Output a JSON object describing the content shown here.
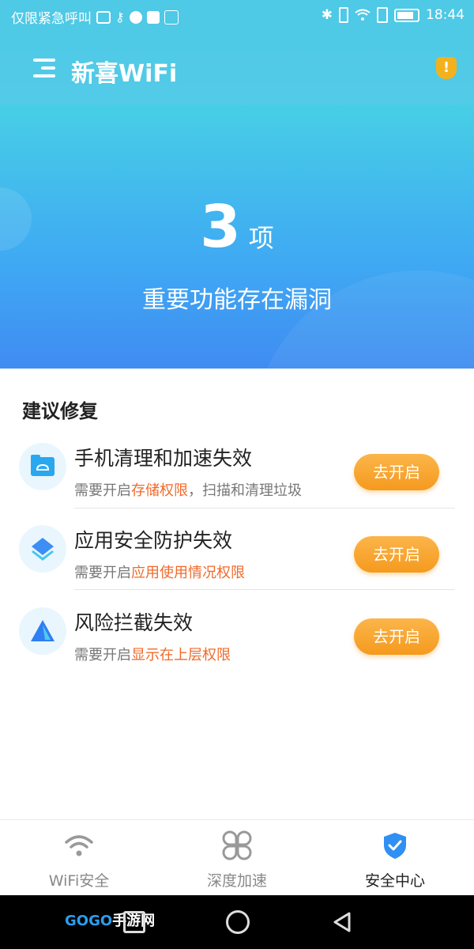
{
  "status_bar": {
    "left_text": "仅限紧急呼叫",
    "time": "18:44"
  },
  "app_bar": {
    "title": "新喜WiFi",
    "alert_mark": "!"
  },
  "hero": {
    "count": "3",
    "unit": "项",
    "subtitle": "重要功能存在漏洞"
  },
  "section": {
    "title": "建议修复"
  },
  "items": [
    {
      "title": "手机清理和加速失效",
      "desc_prefix": "需要开启",
      "desc_highlight": "存储权限",
      "desc_suffix": "，扫描和清理垃圾",
      "button": "去开启",
      "icon": "folder-cloud-icon"
    },
    {
      "title": "应用安全防护失效",
      "desc_prefix": "需要开启",
      "desc_highlight": "应用使用情况权限",
      "desc_suffix": "",
      "button": "去开启",
      "icon": "layers-icon"
    },
    {
      "title": "风险拦截失效",
      "desc_prefix": "需要开启",
      "desc_highlight": "显示在上层权限",
      "desc_suffix": "",
      "button": "去开启",
      "icon": "warning-triangle-icon"
    }
  ],
  "tabs": [
    {
      "label": "WiFi安全",
      "icon": "wifi-icon",
      "active": false
    },
    {
      "label": "深度加速",
      "icon": "four-petal-icon",
      "active": false
    },
    {
      "label": "安全中心",
      "icon": "shield-check-icon",
      "active": true
    }
  ],
  "watermark": {
    "brand": "GOGO",
    "suffix": "手游网"
  },
  "colors": {
    "accent": "#4ec9e6",
    "button": "#f5a42a",
    "highlight": "#f06a2a",
    "active_tab_icon": "#2f8ff3"
  }
}
